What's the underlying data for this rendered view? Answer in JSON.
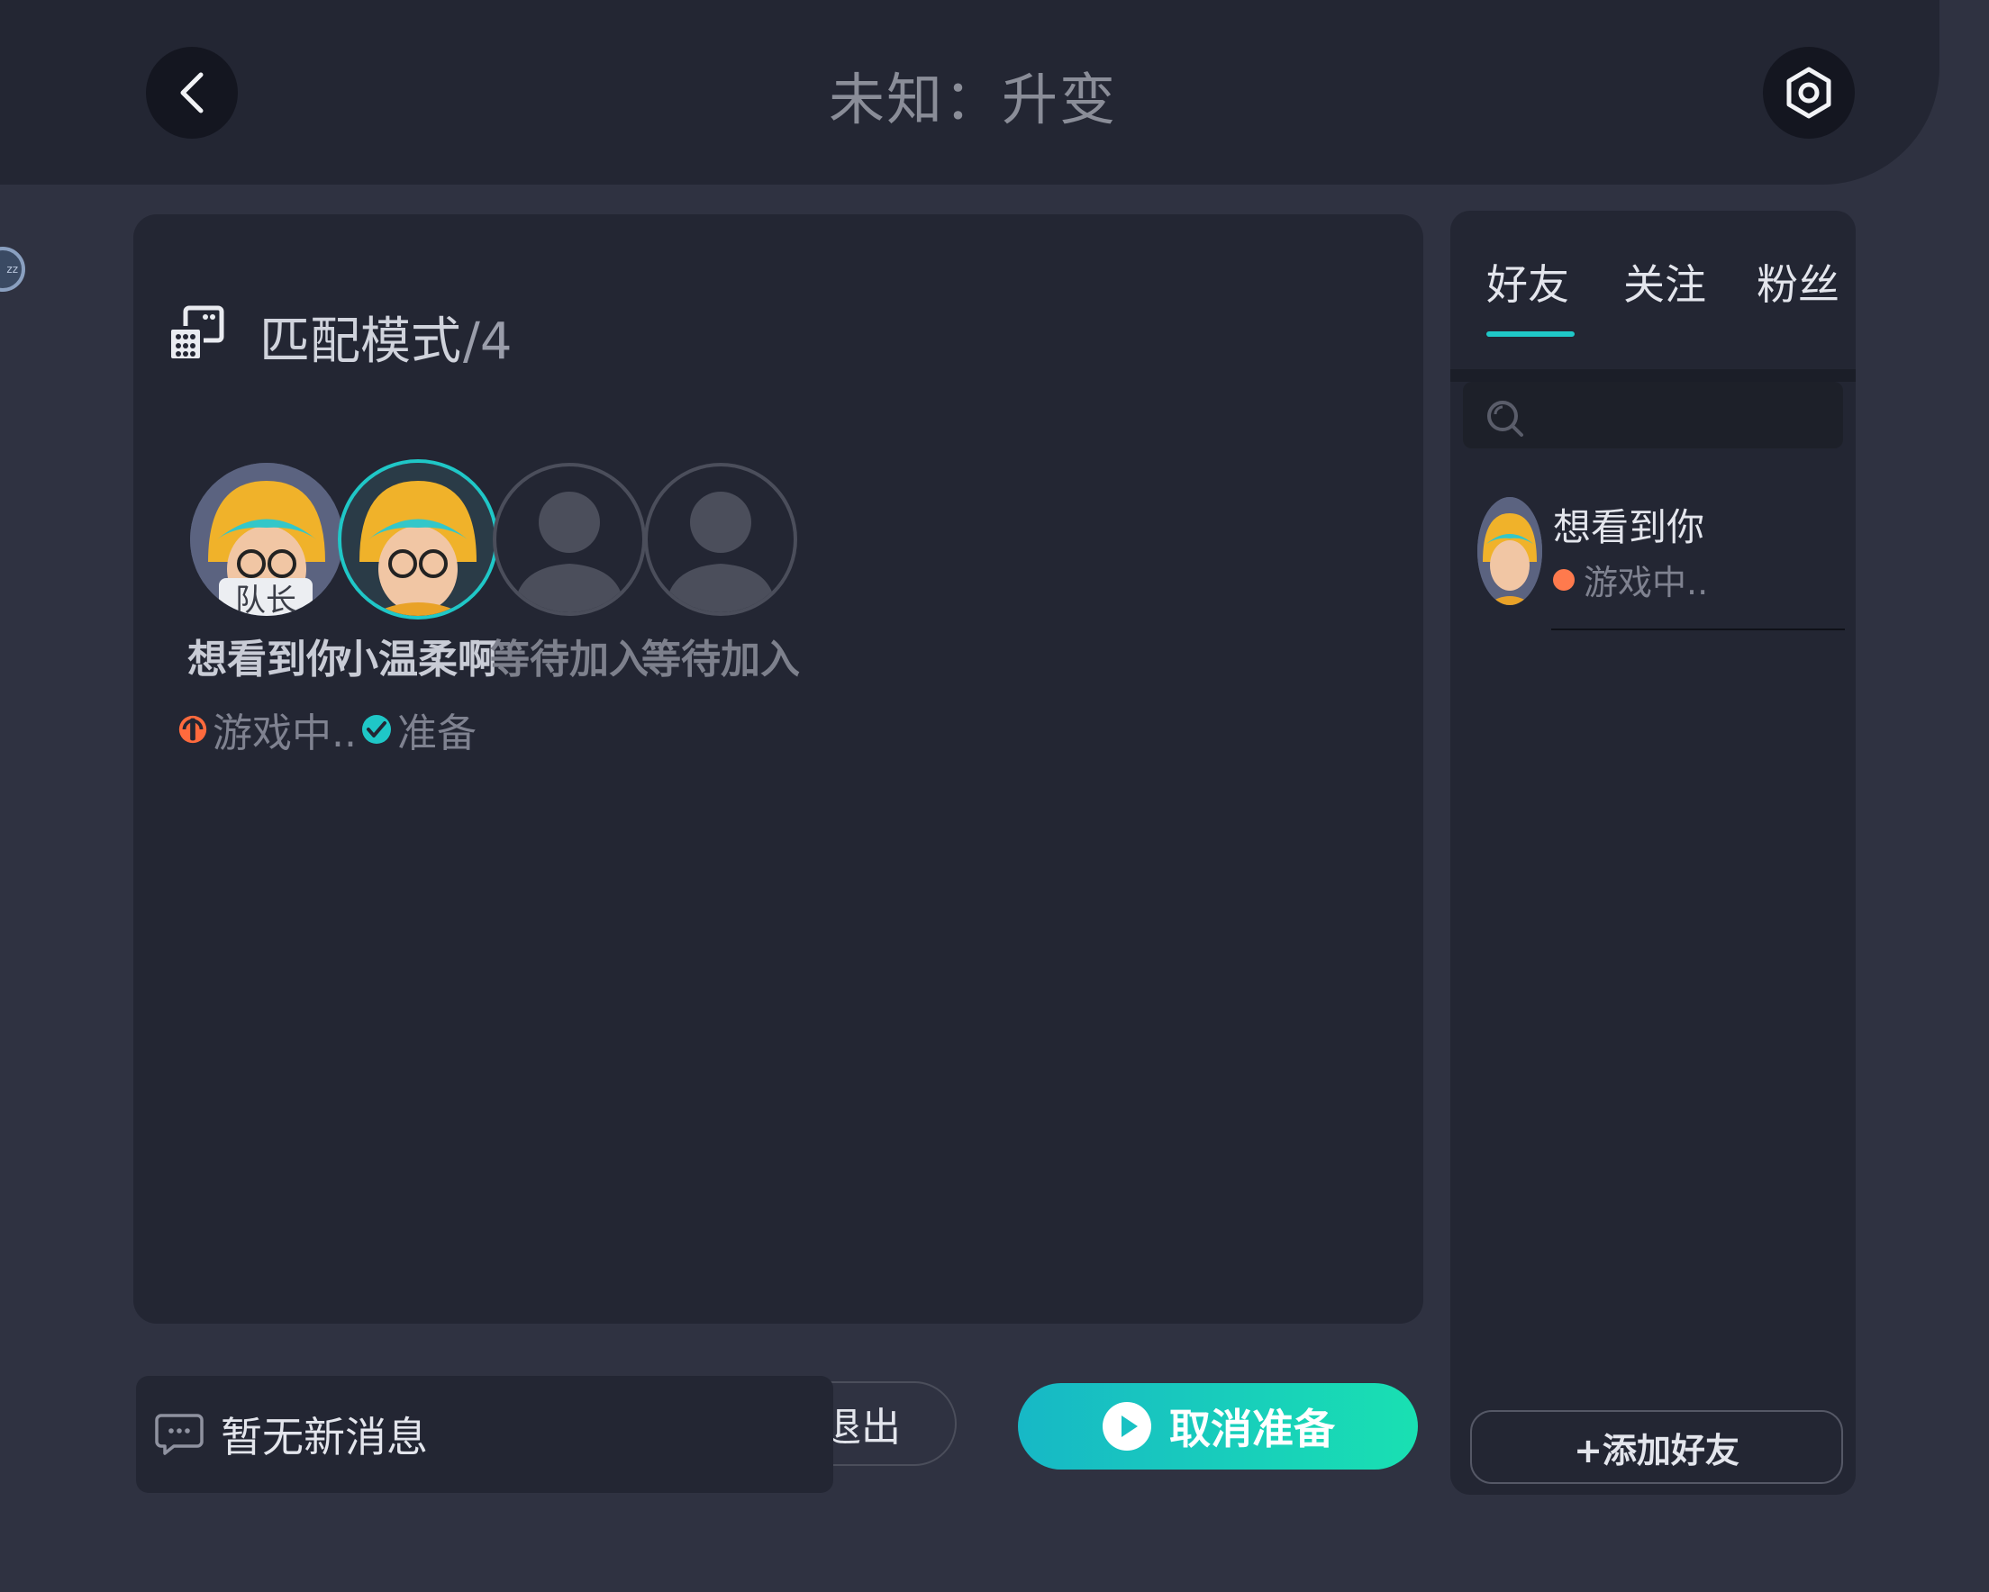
{
  "header": {
    "title": "未知：升变"
  },
  "room": {
    "mode_label": "匹配模式",
    "mode_count": "/4",
    "captain_badge": "队长",
    "slots": [
      {
        "name": "想看到你",
        "status": "游戏中..",
        "status_icon": "in-game-icon",
        "status_color": "#ff6a3d"
      },
      {
        "name": "小温柔啊",
        "status": "准备",
        "status_icon": "check-circle-icon",
        "status_color": "#1fc7c7"
      },
      {
        "name": "等待加入"
      },
      {
        "name": "等待加入"
      }
    ]
  },
  "friends": {
    "tabs": [
      "好友",
      "关注",
      "粉丝"
    ],
    "active_tab": "好友",
    "list": [
      {
        "name": "想看到你",
        "status": "游戏中.."
      }
    ],
    "add_friend_label": "+添加好友"
  },
  "actions": {
    "exit_label": "退出",
    "cancel_ready_label": "取消准备"
  },
  "messages": {
    "empty_text": "暂无新消息"
  },
  "colors": {
    "accent": "#1fc7c7",
    "in_game": "#ff6a3d",
    "background": "#2f3241",
    "panel": "#232633"
  }
}
